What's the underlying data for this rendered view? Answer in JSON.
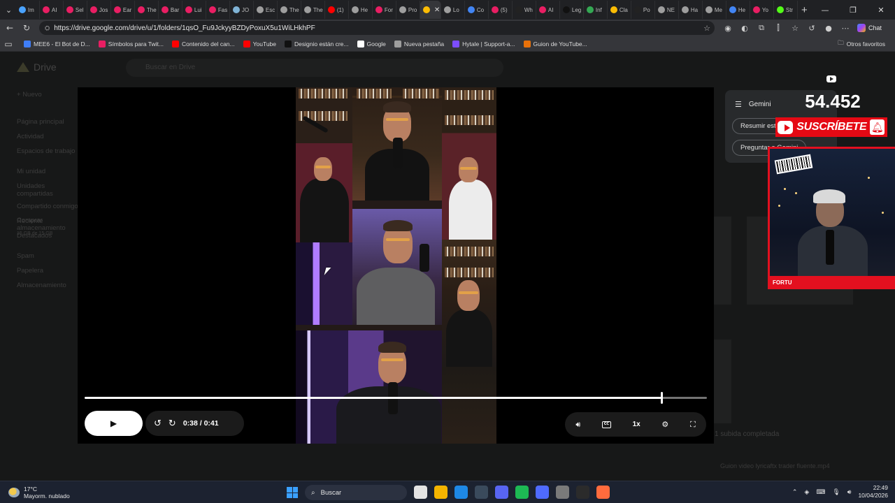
{
  "browser": {
    "tabs": [
      {
        "label": "Im",
        "color": "#4aa3ff"
      },
      {
        "label": "AI",
        "color": "#e91e63"
      },
      {
        "label": "Sel",
        "color": "#e91e63"
      },
      {
        "label": "Jos",
        "color": "#e91e63"
      },
      {
        "label": "Ear",
        "color": "#e91e63"
      },
      {
        "label": "The",
        "color": "#e91e63"
      },
      {
        "label": "Bar",
        "color": "#e91e63"
      },
      {
        "label": "Lui",
        "color": "#e91e63"
      },
      {
        "label": "Fas",
        "color": "#e91e63"
      },
      {
        "label": "JO",
        "color": "#7fb3d5"
      },
      {
        "label": "Esc",
        "color": "#9e9e9e"
      },
      {
        "label": "The",
        "color": "#9e9e9e"
      },
      {
        "label": "The",
        "color": "#9e9e9e"
      },
      {
        "label": "(1)",
        "color": "#ff0000"
      },
      {
        "label": "He",
        "color": "#9e9e9e"
      },
      {
        "label": "For",
        "color": "#e91e63"
      },
      {
        "label": "Pro",
        "color": "#9e9e9e"
      },
      {
        "label": "",
        "color": "#fbbc04",
        "active": true
      },
      {
        "label": "Lo",
        "color": "#9e9e9e"
      },
      {
        "label": "Co",
        "color": "#4285f4"
      },
      {
        "label": "(5)",
        "color": "#e91e63"
      },
      {
        "label": "Wh",
        "color": "#222222"
      },
      {
        "label": "AI",
        "color": "#e91e63"
      },
      {
        "label": "Leg",
        "color": "#111111"
      },
      {
        "label": "Inf",
        "color": "#34a853"
      },
      {
        "label": "Cla",
        "color": "#fbbc04"
      },
      {
        "label": "Po",
        "color": "#222222"
      },
      {
        "label": "NE",
        "color": "#9e9e9e"
      },
      {
        "label": "Ha",
        "color": "#9e9e9e"
      },
      {
        "label": "Me",
        "color": "#9e9e9e"
      },
      {
        "label": "He",
        "color": "#4285f4"
      },
      {
        "label": "Yo",
        "color": "#e91e63"
      },
      {
        "label": "Str",
        "color": "#53fc18"
      }
    ],
    "url": "https://drive.google.com/drive/u/1/folders/1qsO_Fu9JckyyBZDyPoxuX5u1WiLHkhPF",
    "chat_label": "Chat",
    "bookmarks": [
      {
        "label": "MEE6 - El Bot de D...",
        "color": "#3f7ef8"
      },
      {
        "label": "Símbolos para Twit...",
        "color": "#e91e63"
      },
      {
        "label": "Contenido del can...",
        "color": "#ff0000"
      },
      {
        "label": "YouTube",
        "color": "#ff0000"
      },
      {
        "label": "Designio están cre...",
        "color": "#111111"
      },
      {
        "label": "Google",
        "color": "#ffffff"
      },
      {
        "label": "Nueva pestaña",
        "color": "#9e9e9e"
      },
      {
        "label": "Hytale | Support-a...",
        "color": "#7c4dff"
      },
      {
        "label": "Guion de YouTube...",
        "color": "#e8710a"
      }
    ],
    "others_label": "Otros favoritos"
  },
  "drive": {
    "title": "Drive",
    "search_placeholder": "Buscar en Drive",
    "new_label": "Nuevo",
    "sidebar": [
      "Página principal",
      "Actividad",
      "Espacios de trabajo",
      "",
      "Mi unidad",
      "Unidades compartidas",
      "",
      "Compartido conmigo",
      "Reciente",
      "Destacados",
      "",
      "Spam",
      "Papelera",
      "Almacenamiento"
    ],
    "storage_text": "15 GB de 15 GB",
    "upload_text": "1 subida completada",
    "upload_file": "Guion video lyricaftx trader fluente.mp4",
    "buy_storage": "Comprar almacenamiento"
  },
  "player": {
    "time_current": "0:38",
    "time_total": "0:41",
    "progress": 0.927,
    "speed": "1x"
  },
  "gemini": {
    "title": "Gemini",
    "chip1": "Resumir este vídeo",
    "chip2": "Preguntar a Gemini"
  },
  "overlay": {
    "subscriber_count": "54.452",
    "subscribe_label": "SUSCRÍBETE",
    "streamer_name": "FORTU"
  },
  "taskbar": {
    "temperature": "17°C",
    "weather": "Mayorm. nublado",
    "search_label": "Buscar",
    "time": "22:49",
    "date": "10/04/2026",
    "apps": [
      "#e3e3e3",
      "#f4b400",
      "#1e88e5",
      "#3a4a5c",
      "#5865f2",
      "#1db954",
      "#4f6bff",
      "#7a7a7a",
      "#2b2b2b",
      "#ff6b3d"
    ]
  }
}
